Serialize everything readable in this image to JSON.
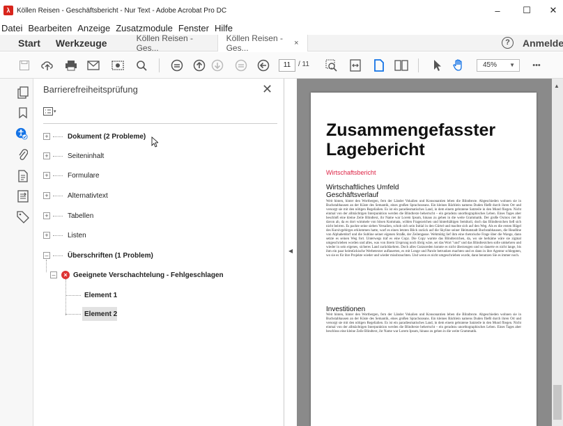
{
  "window": {
    "title": "Köllen Reisen - Geschäftsbericht - Nur Text - Adobe Acrobat Pro DC",
    "minimize": "–",
    "maximize": "☐",
    "close": "✕"
  },
  "menu": [
    "Datei",
    "Bearbeiten",
    "Anzeige",
    "Zusatzmodule",
    "Fenster",
    "Hilfe"
  ],
  "tabs": {
    "start": "Start",
    "tools": "Werkzeuge",
    "doc1": "Köllen Reisen - Ges...",
    "doc2": "Köllen Reisen - Ges...",
    "doc2_close": "×",
    "help": "?",
    "signin": "Anmelden"
  },
  "toolbar": {
    "page_current": "11",
    "page_total": "/ 11",
    "zoom": "45%",
    "more": "•••"
  },
  "panel": {
    "title": "Barrierefreiheitsprüfung",
    "close": "✕",
    "items": [
      {
        "label": "Dokument (2 Probleme)",
        "bold": true
      },
      {
        "label": "Seiteninhalt",
        "bold": false
      },
      {
        "label": "Formulare",
        "bold": false
      },
      {
        "label": "Alternativtext",
        "bold": false
      },
      {
        "label": "Tabellen",
        "bold": false
      },
      {
        "label": "Listen",
        "bold": false
      },
      {
        "label": "Überschriften (1 Problem)",
        "bold": true
      }
    ],
    "sub_item": "Geeignete Verschachtelung - Fehlgeschlagen",
    "elements": [
      "Element 1",
      "Element 2"
    ]
  },
  "document": {
    "title": "Zusammengefasster Lagebericht",
    "subtitle": "Wirtschaftsbericht",
    "h2a": "Wirtschaftliches Umfeld",
    "h2b": "Geschäftsverlauf",
    "para1": "Weit hinten, hinter den Wortbergen, fern der Länder Vokalien und Konsonantien leben die Blindtexte. Abgeschieden wohnen sie in Buchstabhausen an der Küste des Semantik, eines großen Sprachozeans. Ein kleines Bächlein namens Duden fließt durch ihren Ort und versorgt sie mit den nötigen Regelialien. Es ist ein paradiesmatisches Land, in dem einem gebratene Satzteile in den Mund fliegen. Nicht einmal von der allmächtigen Interpunktion werden die Blindtexte beherrscht – ein geradezu unorthographisches Leben. Eines Tages aber beschloß eine kleine Zeile Blindtext, ihr Name war Lorem Ipsum, hinaus zu gehen in die weite Grammatik. Der große Oxmox riet ihr davon ab, da es dort wimmele von bösen Kommata, wilden Fragezeichen und hinterhältigen Semikoli, doch das Blindtextchen ließ sich nicht beirren. Es packte seine sieben Versalien, schob sich sein Initial in den Gürtel und machte sich auf den Weg. Als es die ersten Hügel des Kursivgebirges erklommen hatte, warf es einen letzten Blick zurück auf die Skyline seiner Heimatstadt Buchstabhausen, die Headline von Alphabetdorf und die Subline seiner eigenen Straße, der Zeilengasse. Wehmütig lief ihm eine rhetorische Frage über die Wange, dann setzte es seinen Weg fort. Unterwegs traf es eine Copy. Die Copy warnte das Blindtextchen, da, wo sie herkäme wäre sie zigmal umgeschrieben worden und alles, was von ihrem Ursprung noch übrig wäre, sei das Wort \"und\" und das Blindtextchen solle umkehren und wieder in sein eigenes, sicheres Land zurückkehren. Doch alles Gutzureden konnte es nicht überzeugen und so dauerte es nicht lange, bis ihm ein paar heimtückische Werbetexter auflauerten, es mit Longe und Parole betrunken machten und es dann in ihre Agentur schleppten, wo sie es für ihre Projekte wieder und wieder missbrauchten. Und wenn es nicht umgeschrieben wurde, dann benutzen Sie es immer noch.",
    "h2c": "Investitionen",
    "para2": "Weit hinten, hinter den Wortbergen, fern der Länder Vokalien und Konsonantien leben die Blindtexte. Abgeschieden wohnen sie in Buchstabhausen an der Küste des Semantik, eines großen Sprachozeans. Ein kleines Bächlein namens Duden fließt durch ihren Ort und versorgt sie mit den nötigen Regelialien. Es ist ein paradiesmatisches Land, in dem einem gebratene Satzteile in den Mund fliegen. Nicht einmal von der allmächtigen Interpunktion werden die Blindtexte beherrscht – ein geradezu unorthographisches Leben. Eines Tages aber beschloss eine kleine Zeile Blindtext, ihr Name war Lorem Ipsum, hinaus zu gehen in die weite Grammatik."
  }
}
